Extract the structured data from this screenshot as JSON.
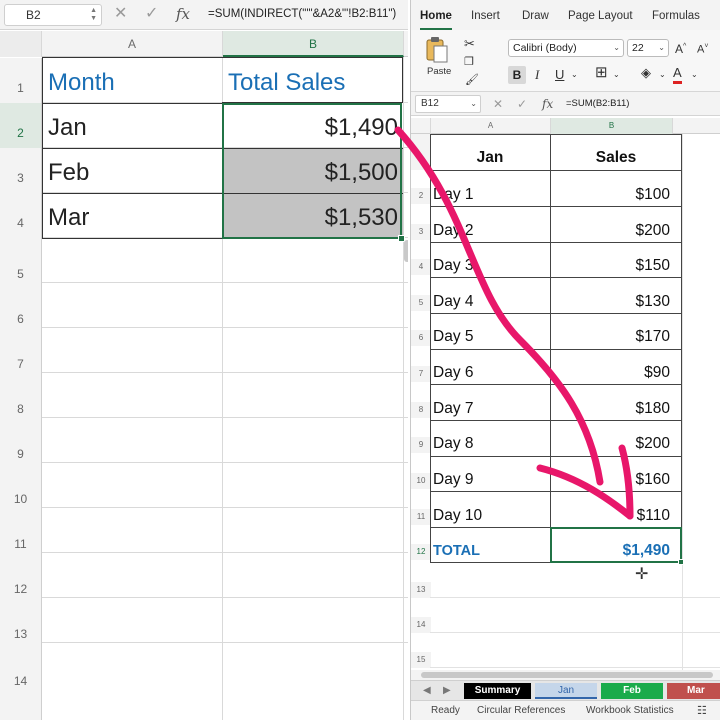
{
  "left_pane": {
    "name_box": "B2",
    "formula": "=SUM(INDIRECT(\"'\"&A2&\"'!B2:B11\")",
    "columns": [
      "A",
      "B"
    ],
    "row_numbers": [
      "1",
      "2",
      "3",
      "4",
      "5",
      "6",
      "7",
      "8",
      "9",
      "10",
      "11",
      "12",
      "13",
      "14"
    ],
    "header": {
      "month": "Month",
      "total_sales": "Total Sales"
    },
    "rows": [
      {
        "month": "Jan",
        "sales": "$1,490"
      },
      {
        "month": "Feb",
        "sales": "$1,500"
      },
      {
        "month": "Mar",
        "sales": "$1,530"
      }
    ]
  },
  "right_pane": {
    "ribbon_tabs": [
      "Home",
      "Insert",
      "Draw",
      "Page Layout",
      "Formulas"
    ],
    "active_tab": "Home",
    "paste_label": "Paste",
    "font_name": "Calibri (Body)",
    "font_size": "22",
    "name_box": "B12",
    "formula": "=SUM(B2:B11)",
    "columns": [
      "A",
      "B"
    ],
    "row_numbers": [
      "2",
      "3",
      "4",
      "5",
      "6",
      "7",
      "8",
      "9",
      "10",
      "11",
      "12",
      "13",
      "14",
      "15"
    ],
    "header": {
      "month": "Jan",
      "sales": "Sales"
    },
    "rows": [
      {
        "day": "Day 1",
        "sales": "$100"
      },
      {
        "day": "Day 2",
        "sales": "$200"
      },
      {
        "day": "Day 3",
        "sales": "$150"
      },
      {
        "day": "Day 4",
        "sales": "$130"
      },
      {
        "day": "Day 5",
        "sales": "$170"
      },
      {
        "day": "Day 6",
        "sales": "$90"
      },
      {
        "day": "Day 7",
        "sales": "$180"
      },
      {
        "day": "Day 8",
        "sales": "$200"
      },
      {
        "day": "Day 9",
        "sales": "$160"
      },
      {
        "day": "Day 10",
        "sales": "$110"
      }
    ],
    "total": {
      "label": "TOTAL",
      "value": "$1,490"
    },
    "sheet_tabs": [
      {
        "name": "Summary",
        "bg": "#000000",
        "fg": "#ffffff"
      },
      {
        "name": "Jan",
        "bg": "#c5d6ea",
        "fg": "#3366aa"
      },
      {
        "name": "Feb",
        "bg": "#1aab4b",
        "fg": "#ffffff"
      },
      {
        "name": "Mar",
        "bg": "#c0504d",
        "fg": "#ffffff"
      }
    ],
    "status": {
      "ready": "Ready",
      "circular": "Circular References",
      "workbook": "Workbook Statistics"
    }
  },
  "colors": {
    "excel_green": "#217346",
    "header_blue": "#1a6fb5",
    "arrow_pink": "#e8176a",
    "gray_fill": "#c3c3c3"
  },
  "icons": [
    "cancel-icon",
    "confirm-icon",
    "fx-icon",
    "paste-icon",
    "cut-icon",
    "copy-icon",
    "format-painter-icon",
    "fill-color-icon",
    "font-color-icon",
    "borders-icon",
    "move-cursor-icon"
  ]
}
